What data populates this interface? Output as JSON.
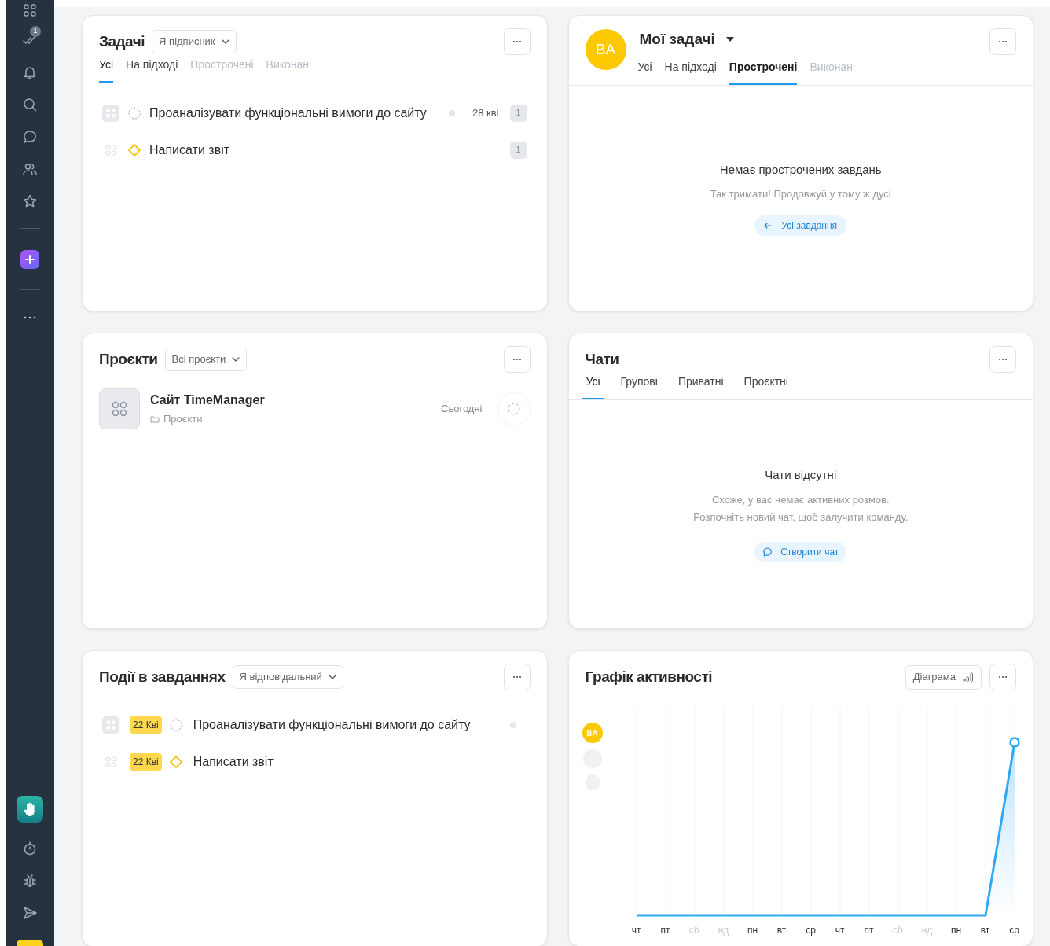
{
  "sidebar": {
    "task_badge": "1"
  },
  "tasks": {
    "title": "Задачі",
    "filter": "Я підписник",
    "tabs": [
      {
        "label": "Усі",
        "selected": true,
        "disabled": false
      },
      {
        "label": "На підході",
        "selected": false,
        "disabled": false
      },
      {
        "label": "Прострочені",
        "selected": false,
        "disabled": true
      },
      {
        "label": "Виконані",
        "selected": false,
        "disabled": true
      }
    ],
    "items": [
      {
        "title": "Проаналізувати функціональні вимоги до сайту",
        "kind": "in_progress",
        "date": "28 кві",
        "count": "1"
      },
      {
        "title": "Написати звіт",
        "kind": "new",
        "count": "1"
      }
    ]
  },
  "my_tasks": {
    "avatar": "BA",
    "title": "Мої задачі",
    "tabs": [
      {
        "label": "Усі",
        "selected": false,
        "disabled": false
      },
      {
        "label": "На підході",
        "selected": false,
        "disabled": false
      },
      {
        "label": "Прострочені",
        "selected": true,
        "disabled": false
      },
      {
        "label": "Виконані",
        "selected": false,
        "disabled": true
      }
    ],
    "empty_title": "Немає прострочених завдань",
    "empty_text": "Так тримати! Продовжуй у тому ж дусі",
    "action": "Усі завдання"
  },
  "projects": {
    "title": "Проєкти",
    "filter": "Всі проєкти",
    "items": [
      {
        "name": "Сайт TimeManager",
        "folder": "Проєкти",
        "date": "Сьогодні"
      }
    ]
  },
  "chats": {
    "title": "Чати",
    "tabs": [
      {
        "label": "Усі",
        "selected": true
      },
      {
        "label": "Групові",
        "selected": false
      },
      {
        "label": "Приватні",
        "selected": false
      },
      {
        "label": "Проєктні",
        "selected": false
      }
    ],
    "empty_title": "Чати відсутні",
    "empty_text": "Схоже, у вас немає активних розмов.\nРозпочніть новий чат, щоб залучити команду.",
    "action": "Створити чат"
  },
  "events": {
    "title": "Події в завданнях",
    "filter": "Я відповідальний",
    "items": [
      {
        "date": "22 Кві",
        "title": "Проаналізувати функціональні вимоги до сайту",
        "kind": "in_progress"
      },
      {
        "date": "22 Кві",
        "title": "Написати звіт",
        "kind": "new"
      }
    ]
  },
  "activity": {
    "title": "Графік активності",
    "view": "Діаграма",
    "legend_avatar": "BA",
    "days": [
      {
        "label": "чт",
        "weekend": false
      },
      {
        "label": "пт",
        "weekend": false
      },
      {
        "label": "сб",
        "weekend": true
      },
      {
        "label": "нд",
        "weekend": true
      },
      {
        "label": "пн",
        "weekend": false
      },
      {
        "label": "вт",
        "weekend": false
      },
      {
        "label": "ср",
        "weekend": false
      },
      {
        "label": "чт",
        "weekend": false
      },
      {
        "label": "пт",
        "weekend": false
      },
      {
        "label": "сб",
        "weekend": true
      },
      {
        "label": "нд",
        "weekend": true
      },
      {
        "label": "пн",
        "weekend": false
      },
      {
        "label": "вт",
        "weekend": false
      },
      {
        "label": "ср",
        "weekend": false
      }
    ]
  }
}
